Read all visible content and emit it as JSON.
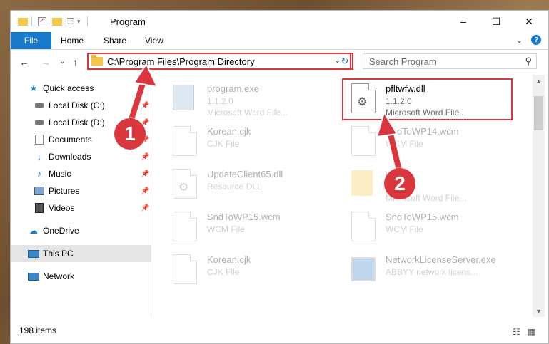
{
  "window": {
    "title": "Program",
    "controls": [
      "–",
      "☐",
      "✕"
    ]
  },
  "ribbon": {
    "tabs": [
      "File",
      "Home",
      "Share",
      "View"
    ]
  },
  "address": {
    "path": "C:\\Program Files\\Program Directory",
    "search_placeholder": "Search Program"
  },
  "sidebar": {
    "items": [
      {
        "label": "Quick access",
        "icon": "star-icon"
      },
      {
        "label": "Local Disk (C:)",
        "icon": "drive-icon",
        "pinned": true
      },
      {
        "label": "Local Disk (D:)",
        "icon": "drive-icon",
        "pinned": true
      },
      {
        "label": "Documents",
        "icon": "documents-icon",
        "pinned": true
      },
      {
        "label": "Downloads",
        "icon": "download-icon",
        "pinned": true
      },
      {
        "label": "Music",
        "icon": "music-icon",
        "pinned": true
      },
      {
        "label": "Pictures",
        "icon": "pictures-icon",
        "pinned": true
      },
      {
        "label": "Videos",
        "icon": "videos-icon",
        "pinned": true
      },
      {
        "label": "OneDrive",
        "icon": "cloud-icon"
      },
      {
        "label": "This PC",
        "icon": "computer-icon",
        "selected": true
      },
      {
        "label": "Network",
        "icon": "network-icon"
      }
    ]
  },
  "files": [
    {
      "name": "program.exe",
      "line2": "1.1.2.0",
      "line3": "Microsoft Word File...",
      "faded": true
    },
    {
      "name": "pfltwfw.dll",
      "line2": "1.1.2.0",
      "line3": "Microsoft Word File...",
      "faded": false,
      "highlighted": true
    },
    {
      "name": "Korean.cjk",
      "line2": "CJK File",
      "line3": "",
      "faded": true
    },
    {
      "name": "SndToWP14.wcm",
      "line2": "WCM File",
      "line3": "",
      "faded": true
    },
    {
      "name": "UpdateClient65.dll",
      "line2": "Resource DLL",
      "line3": "",
      "faded": true
    },
    {
      "name": "ufo",
      "line2": "",
      "line3": "Microsoft Word File...",
      "faded": true
    },
    {
      "name": "SndToWP15.wcm",
      "line2": "WCM File",
      "line3": "",
      "faded": true
    },
    {
      "name": "SndToWP15.wcm",
      "line2": "WCM File",
      "line3": "",
      "faded": true
    },
    {
      "name": "Korean.cjk",
      "line2": "CJK File",
      "line3": "",
      "faded": true
    },
    {
      "name": "NetworkLicenseServer.exe",
      "line2": "ABBYY network licens...",
      "line3": "",
      "faded": true
    }
  ],
  "status": {
    "item_count": "198 items"
  },
  "callouts": [
    "1",
    "2"
  ],
  "colors": {
    "accent": "#1979ca",
    "highlight": "#d9363e"
  }
}
